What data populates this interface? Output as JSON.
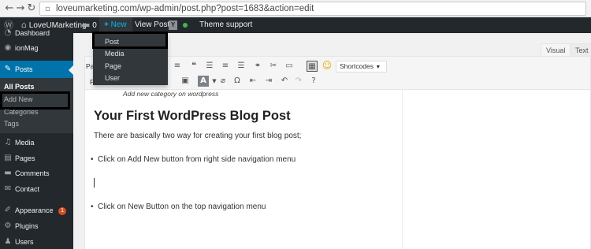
{
  "browser": {
    "url": "loveumarketing.com/wp-admin/post.php?post=1683&action=edit",
    "url_icon": "page-icon"
  },
  "adminbar": {
    "site_name": "LoveUMarketing",
    "comments_count": "0",
    "new_label": "New",
    "view_post_label": "View Post",
    "plugin_label": "Y",
    "theme_support_label": "Theme support",
    "status_color": "#46b450"
  },
  "new_menu": {
    "items": [
      "Post",
      "Media",
      "Page",
      "User"
    ]
  },
  "sidebar": {
    "items": [
      {
        "label": "Dashboard",
        "icon": "dashboard-icon"
      },
      {
        "label": "ionMag",
        "icon": "ionmag-icon"
      },
      {
        "label": "Posts",
        "icon": "pin-icon"
      },
      {
        "label": "Media",
        "icon": "media-icon"
      },
      {
        "label": "Pages",
        "icon": "pages-icon"
      },
      {
        "label": "Comments",
        "icon": "comment-icon"
      },
      {
        "label": "Contact",
        "icon": "mail-icon"
      },
      {
        "label": "Appearance",
        "icon": "brush-icon",
        "badge": "1"
      },
      {
        "label": "Plugins",
        "icon": "plugin-icon"
      },
      {
        "label": "Users",
        "icon": "users-icon"
      }
    ],
    "submenu": [
      "All Posts",
      "Add New",
      "Categories",
      "Tags"
    ]
  },
  "editor": {
    "tabs": [
      "Visual",
      "Text"
    ],
    "paragraph_select": "Paragraph",
    "font_select": "Font",
    "shortcodes_label": "Shortcodes"
  },
  "content": {
    "caption": "Add new category on wordpress",
    "heading": "Your First WordPress Blog Post",
    "intro": "There are basically two way for creating your first blog post;",
    "bullet1": "Click on Add New button from right side navigation menu",
    "bullet2": "Click on New Button on the top navigation menu"
  },
  "colors": {
    "accent": "#0073aa",
    "adminbar": "#23282d",
    "new_highlight": "#00b9eb",
    "badge": "#d54e21"
  }
}
